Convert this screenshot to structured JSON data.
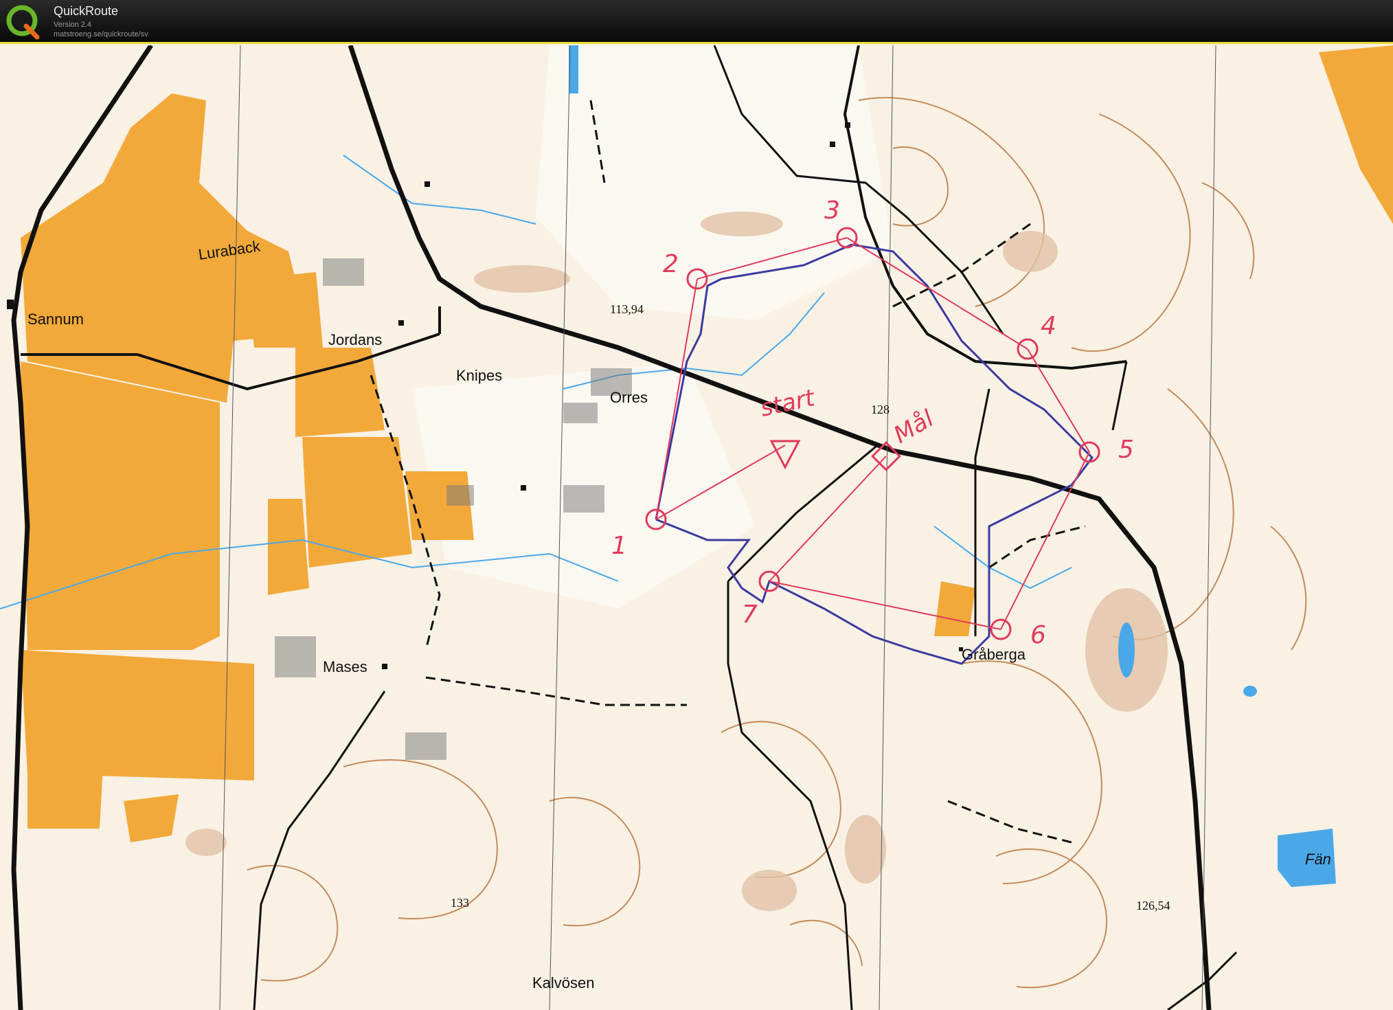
{
  "app": {
    "title": "QuickRoute",
    "version": "Version 2.4",
    "url": "matstroeng.se/quickroute/sv",
    "accent_color": "#e8dc3a",
    "logo_icon": "quickroute-q-logo-icon"
  },
  "map": {
    "place_names": {
      "luraback": "Luraback",
      "sannum": "Sannum",
      "jordans": "Jordans",
      "knipes": "Knipes",
      "orres": "Orres",
      "mases": "Mases",
      "graberga": "Gråberga",
      "kalvosen": "Kalvösen",
      "fan": "Fän"
    },
    "spot_heights": {
      "h1": "113,94",
      "h2": "128",
      "h3": "133",
      "h4": "126,54"
    },
    "course": {
      "color": "#e03a5a",
      "start_label": "start",
      "finish_label": "Mål",
      "controls": [
        "1",
        "2",
        "3",
        "4",
        "5",
        "6",
        "7"
      ]
    },
    "route": {
      "color": "#3a3aa0"
    },
    "colors": {
      "field": "#f2a93a",
      "contour": "#c58a5a",
      "water": "#4aa8e8",
      "road": "#111111"
    }
  }
}
